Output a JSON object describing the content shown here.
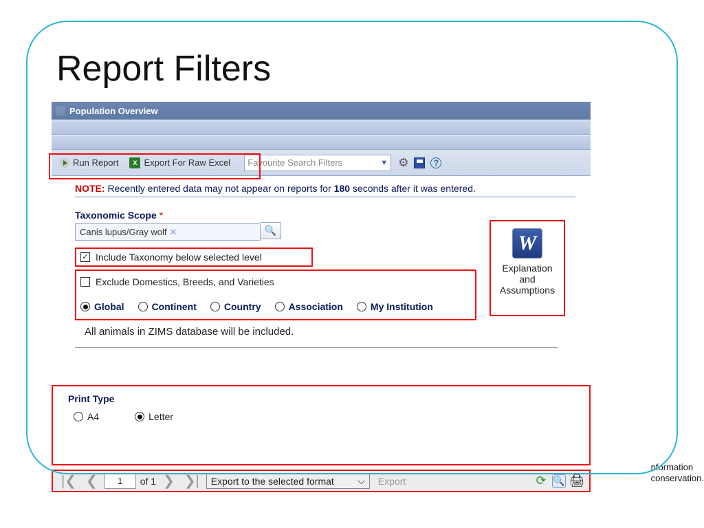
{
  "page_title": "Report Filters",
  "titlebar": {
    "label": "Population Overview"
  },
  "toolbar": {
    "run_label": "Run Report",
    "export_label": "Export For Raw Excel",
    "excel_glyph": "X",
    "fav_placeholder": "Favourite Search Filters",
    "gear_glyph": "⚙",
    "help_glyph": "?"
  },
  "note": {
    "tag": "NOTE:",
    "prefix": "Recently entered data may not appear on reports for ",
    "seconds": "180",
    "suffix": " seconds after it was entered."
  },
  "tax": {
    "section_label": "Taxonomic Scope",
    "asterisk": "*",
    "value": "Canis lupus/Gray wolf",
    "clear_glyph": "✕",
    "search_glyph": "🔍",
    "include_label": "Include Taxonomy below selected level",
    "exclude_label": "Exclude Domestics, Breeds, and Varieties",
    "scope_options": [
      "Global",
      "Continent",
      "Country",
      "Association",
      "My Institution"
    ],
    "selected_scope_index": 0,
    "info_line": "All animals in ZIMS database will be included."
  },
  "explain": {
    "icon_glyph": "W",
    "line1": "Explanation",
    "line2": "and",
    "line3": "Assumptions"
  },
  "print": {
    "section_label": "Print Type",
    "options": [
      "A4",
      "Letter"
    ],
    "selected_index": 1
  },
  "pager": {
    "first_glyph": "|❮",
    "prev_glyph": "❮",
    "page_value": "1",
    "of_label": "of 1",
    "next_glyph": "❯",
    "last_glyph": "❯|",
    "export_select": "Export to the selected format",
    "export_chevron": "⌵",
    "export_label": "Export",
    "refresh_glyph": "⟳",
    "view_glyph": "🔍",
    "print_glyph": "🖨"
  },
  "footer": {
    "l1": "nformation",
    "l2": "conservation."
  }
}
